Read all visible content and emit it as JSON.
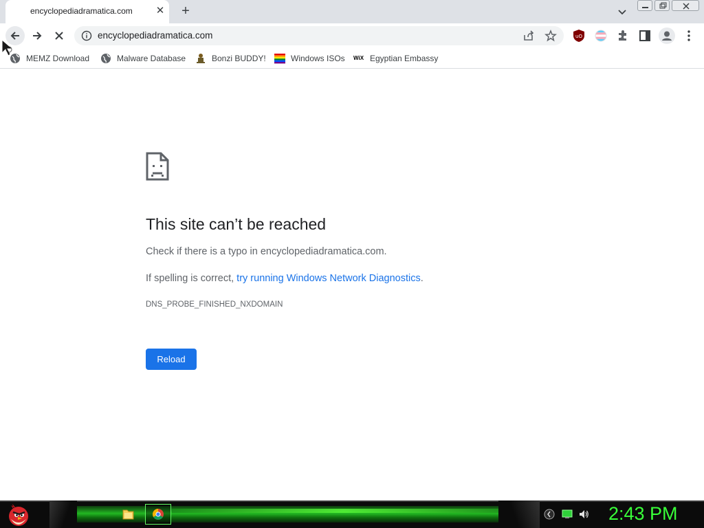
{
  "tab": {
    "title": "encyclopediadramatica.com",
    "close": "✕",
    "new_tab": "+"
  },
  "omnibox": {
    "url": "encyclopediadramatica.com"
  },
  "bookmarks": [
    {
      "label": "MEMZ Download",
      "icon": "globe-icon"
    },
    {
      "label": "Malware Database",
      "icon": "globe-icon"
    },
    {
      "label": "Bonzi BUDDY!",
      "icon": "bonzi-icon"
    },
    {
      "label": "Windows ISOs",
      "icon": "rainbow-flag-icon"
    },
    {
      "label": "Egyptian Embassy",
      "icon": "wix-icon",
      "icon_text": "WiX"
    }
  ],
  "error": {
    "title": "This site can’t be reached",
    "line1": "Check if there is a typo in encyclopediadramatica.com.",
    "line2_prefix": "If spelling is correct, ",
    "line2_link": "try running Windows Network Diagnostics",
    "line2_suffix": ".",
    "code": "DNS_PROBE_FINISHED_NXDOMAIN",
    "reload_label": "Reload"
  },
  "taskbar": {
    "clock": "2:43 PM"
  },
  "colors": {
    "accent": "#1a73e8",
    "clock": "#39ff39",
    "taskbar_green": "#22b822"
  }
}
